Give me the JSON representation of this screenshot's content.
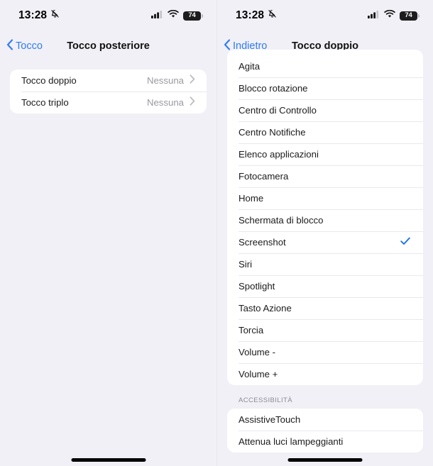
{
  "status_bar": {
    "time": "13:28",
    "silent_icon": "bell-slash-icon",
    "cellular_icon": "cellular-bars-icon",
    "wifi_icon": "wifi-icon",
    "battery_level": "74"
  },
  "colors": {
    "accent_blue": "#2f7cf6",
    "checkmark_blue": "#1a73e8",
    "background": "#f1f0f6",
    "card": "#ffffff",
    "separator": "#e9e8ed",
    "secondary_text": "#9a9aa0"
  },
  "left_screen": {
    "nav": {
      "back_label": "Tocco",
      "back_icon": "chevron-left-icon",
      "title": "Tocco posteriore"
    },
    "rows": [
      {
        "label": "Tocco doppio",
        "value": "Nessuna",
        "accessory": "chevron-right-icon"
      },
      {
        "label": "Tocco triplo",
        "value": "Nessuna",
        "accessory": "chevron-right-icon"
      }
    ]
  },
  "right_screen": {
    "nav": {
      "back_label": "Indietro",
      "back_icon": "chevron-left-icon",
      "title": "Tocco doppio"
    },
    "actions": [
      {
        "label": "Agita",
        "selected": false
      },
      {
        "label": "Blocco rotazione",
        "selected": false
      },
      {
        "label": "Centro di Controllo",
        "selected": false
      },
      {
        "label": "Centro Notifiche",
        "selected": false
      },
      {
        "label": "Elenco applicazioni",
        "selected": false
      },
      {
        "label": "Fotocamera",
        "selected": false
      },
      {
        "label": "Home",
        "selected": false
      },
      {
        "label": "Schermata di blocco",
        "selected": false
      },
      {
        "label": "Screenshot",
        "selected": true
      },
      {
        "label": "Siri",
        "selected": false
      },
      {
        "label": "Spotlight",
        "selected": false
      },
      {
        "label": "Tasto Azione",
        "selected": false
      },
      {
        "label": "Torcia",
        "selected": false
      },
      {
        "label": "Volume -",
        "selected": false
      },
      {
        "label": "Volume +",
        "selected": false
      }
    ],
    "section_header": "ACCESSIBILITÀ",
    "accessibility": [
      {
        "label": "AssistiveTouch",
        "selected": false
      },
      {
        "label": "Attenua luci lampeggianti",
        "selected": false
      }
    ]
  }
}
